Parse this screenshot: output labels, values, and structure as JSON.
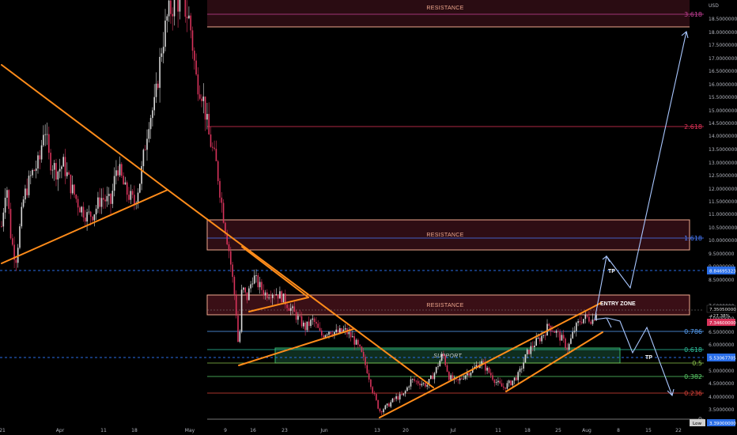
{
  "axis": {
    "currency": "USD",
    "y_ticks": [
      "18.5000000",
      "18.0000000",
      "17.5000000",
      "17.0000000",
      "16.5000000",
      "16.0000000",
      "15.5000000",
      "15.0000000",
      "14.5000000",
      "14.0000000",
      "13.5000000",
      "13.0000000",
      "12.5000000",
      "12.0000000",
      "11.5000000",
      "11.0000000",
      "10.5000000",
      "10.0000000",
      "9.5000000",
      "9.0000000",
      "8.5000000",
      "7.5000000",
      "7.0000000",
      "6.5000000",
      "6.0000000",
      "5.0000000",
      "4.5000000",
      "4.0000000",
      "3.5000000"
    ],
    "x_ticks": [
      "21",
      "Apr",
      "11",
      "18",
      "May",
      "9",
      "16",
      "23",
      "Jun",
      "13",
      "20",
      "Jul",
      "11",
      "18",
      "25",
      "Aug",
      "8",
      "15",
      "22"
    ]
  },
  "price_tags": {
    "upper": {
      "text": "8.84695323",
      "color": "#2a6ee8"
    },
    "current_top": "7.35050000",
    "current_pct": "+27.38%",
    "current_bottom": "7.34600000",
    "support": {
      "text": "5.53067705",
      "color": "#2a6ee8"
    },
    "bottom_partial": "Low",
    "bottom_value": "3.39000000"
  },
  "zones": {
    "resistance_top": "RESISTANCE",
    "resistance_mid": "RESISTANCE",
    "resistance_entry": "RESISTANCE",
    "support": "SUPPORT"
  },
  "fib_levels": [
    {
      "label": "3.618",
      "price": 18.55,
      "color": "#c9419a"
    },
    {
      "label": "2.618",
      "price": 14.45,
      "color": "#e8345a"
    },
    {
      "label": "1.618",
      "price": 10.05,
      "color": "#4a7dff"
    },
    {
      "label": "0.786",
      "price": 6.55,
      "color": "#5aa6ff"
    },
    {
      "label": "0.618",
      "price": 5.85,
      "color": "#2ec4a0"
    },
    {
      "label": "0.5",
      "price": 5.35,
      "color": "#8bc34a"
    },
    {
      "label": "0.382",
      "price": 4.85,
      "color": "#5cd06a"
    },
    {
      "label": "0.236",
      "price": 4.1,
      "color": "#e0443a"
    },
    {
      "label": "0",
      "price": 3.0,
      "color": "#9e9e9e"
    }
  ],
  "annotations": {
    "entry_zone": "ENTRY ZONE",
    "tp1": "TP",
    "tp2": "TP"
  },
  "colors": {
    "bull": "#d9d9d9",
    "bear": "#d8335b",
    "trendline": "#ff8c1a",
    "projection": "#a9c7ff",
    "resistance_border": "#f0a98e",
    "resistance_fill": "#3a0f16",
    "support_fill": "#0f2e1f",
    "support_border": "#35b36a"
  },
  "chart_data": {
    "type": "candlestick",
    "symbol_unit": "USD",
    "ylim": [
      3.0,
      19.0
    ],
    "x_labels": [
      "21",
      "Apr",
      "11",
      "18",
      "May",
      "9",
      "16",
      "23",
      "Jun",
      "13",
      "20",
      "Jul",
      "11",
      "18",
      "25",
      "Aug",
      "8",
      "15",
      "22"
    ],
    "price_path_approx": [
      {
        "t": "21 Mar",
        "close": 11.5
      },
      {
        "t": "Apr",
        "close": 12.8
      },
      {
        "t": "11 Apr",
        "close": 11.6
      },
      {
        "t": "18 Apr",
        "close": 12.3
      },
      {
        "t": "late Apr",
        "close": 18.8
      },
      {
        "t": "May",
        "close": 19.0
      },
      {
        "t": "9 May",
        "close": 9.8
      },
      {
        "t": "10 May",
        "close": 5.5
      },
      {
        "t": "16 May",
        "close": 8.6
      },
      {
        "t": "23 May",
        "close": 7.6
      },
      {
        "t": "Jun",
        "close": 6.2
      },
      {
        "t": "13 Jun",
        "close": 3.3
      },
      {
        "t": "20 Jun",
        "close": 4.4
      },
      {
        "t": "Jul",
        "close": 5.0
      },
      {
        "t": "11 Jul",
        "close": 4.2
      },
      {
        "t": "18 Jul",
        "close": 6.3
      },
      {
        "t": "25 Jul",
        "close": 5.8
      },
      {
        "t": "Aug",
        "close": 7.35
      }
    ],
    "levels": {
      "resistance_zones": [
        [
          18.0,
          19.0
        ],
        [
          9.6,
          10.8
        ],
        [
          7.05,
          7.85
        ]
      ],
      "support_zone": [
        5.35,
        5.95
      ],
      "marked_prices": [
        8.84695323,
        7.3505,
        7.346,
        5.53067705,
        3.39
      ]
    }
  }
}
